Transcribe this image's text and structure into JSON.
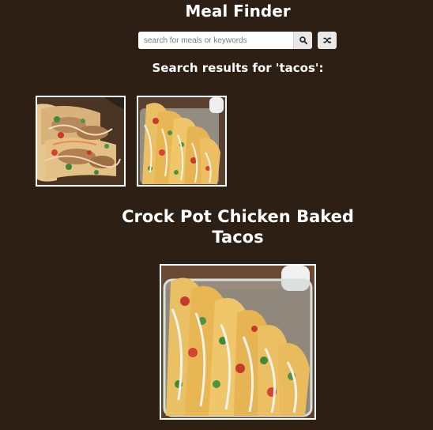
{
  "app": {
    "title": "Meal Finder"
  },
  "search": {
    "placeholder": "search for meals or keywords",
    "value": ""
  },
  "results": {
    "heading": "Search results for 'tacos':"
  },
  "selected_meal": {
    "title": "Crock Pot Chicken Baked Tacos"
  },
  "icons": {
    "search": "search-icon",
    "random": "shuffle-icon"
  },
  "colors": {
    "background": "#2d1f14",
    "text": "#ffffff"
  }
}
